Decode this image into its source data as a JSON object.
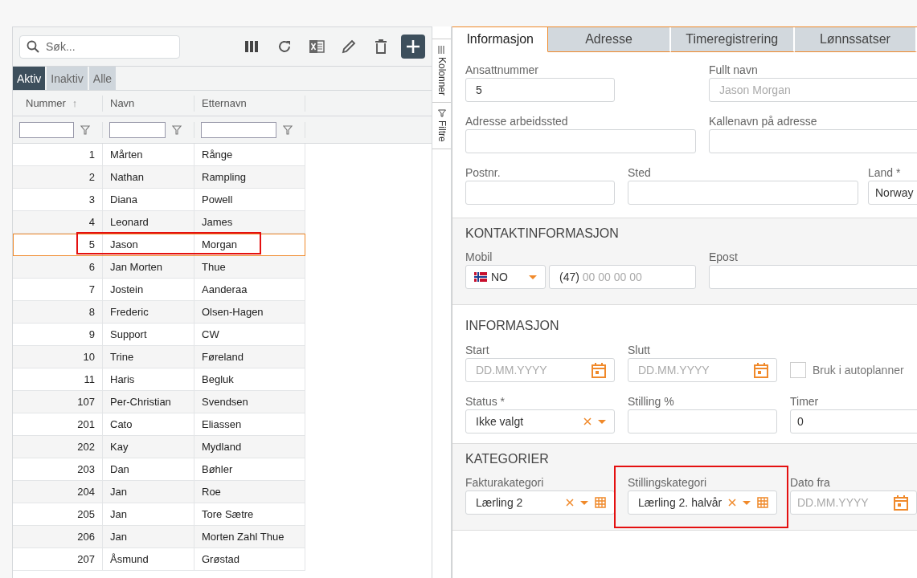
{
  "list_panel": {
    "search": {
      "placeholder": "Søk..."
    },
    "toolbar_buttons": [
      {
        "kind": "columns"
      },
      {
        "kind": "refresh"
      },
      {
        "kind": "excel"
      },
      {
        "kind": "edit"
      },
      {
        "kind": "delete"
      },
      {
        "kind": "add"
      }
    ],
    "filter_tabs": [
      {
        "label": "Aktiv",
        "selected": true
      },
      {
        "label": "Inaktiv",
        "selected": false
      },
      {
        "label": "Alle",
        "selected": false
      }
    ],
    "table": {
      "columns": [
        {
          "label": "Nummer",
          "sort_indicator": "↑"
        },
        {
          "label": "Navn"
        },
        {
          "label": "Etternavn"
        }
      ],
      "rows": [
        {
          "cells": [
            "1",
            "Mårten",
            "Rånge"
          ],
          "selected": false,
          "highlighted": false
        },
        {
          "cells": [
            "2",
            "Nathan",
            "Rampling"
          ],
          "selected": false,
          "highlighted": false
        },
        {
          "cells": [
            "3",
            "Diana",
            "Powell"
          ],
          "selected": false,
          "highlighted": false
        },
        {
          "cells": [
            "4",
            "Leonard",
            "James"
          ],
          "selected": false,
          "highlighted": false
        },
        {
          "cells": [
            "5",
            "Jason",
            "Morgan"
          ],
          "selected": true,
          "highlighted": true
        },
        {
          "cells": [
            "6",
            "Jan Morten",
            "Thue"
          ],
          "selected": false,
          "highlighted": false
        },
        {
          "cells": [
            "7",
            "Jostein",
            "Aanderaa"
          ],
          "selected": false,
          "highlighted": false
        },
        {
          "cells": [
            "8",
            "Frederic",
            "Olsen-Hagen"
          ],
          "selected": false,
          "highlighted": false
        },
        {
          "cells": [
            "9",
            "Support",
            "CW"
          ],
          "selected": false,
          "highlighted": false
        },
        {
          "cells": [
            "10",
            "Trine",
            "Føreland"
          ],
          "selected": false,
          "highlighted": false
        },
        {
          "cells": [
            "11",
            "Haris",
            "Begluk"
          ],
          "selected": false,
          "highlighted": false
        },
        {
          "cells": [
            "107",
            "Per-Christian",
            "Svendsen"
          ],
          "selected": false,
          "highlighted": false
        },
        {
          "cells": [
            "201",
            "Cato",
            "Eliassen"
          ],
          "selected": false,
          "highlighted": false
        },
        {
          "cells": [
            "202",
            "Kay",
            "Mydland"
          ],
          "selected": false,
          "highlighted": false
        },
        {
          "cells": [
            "203",
            "Dan",
            "Bøhler"
          ],
          "selected": false,
          "highlighted": false
        },
        {
          "cells": [
            "204",
            "Jan",
            "Roe"
          ],
          "selected": false,
          "highlighted": false
        },
        {
          "cells": [
            "205",
            "Jan",
            "Tore Sætre"
          ],
          "selected": false,
          "highlighted": false
        },
        {
          "cells": [
            "206",
            "Jan",
            "Morten Zahl Thue"
          ],
          "selected": false,
          "highlighted": false
        },
        {
          "cells": [
            "207",
            "Åsmund",
            "Grøstad"
          ],
          "selected": false,
          "highlighted": false
        }
      ]
    }
  },
  "side_tabs": [
    {
      "label": "Kolonner",
      "kind": "columns"
    },
    {
      "label": "Filtre",
      "kind": "filter"
    }
  ],
  "detail": {
    "tabs": [
      {
        "label": "Informasjon",
        "selected": true
      },
      {
        "label": "Adresse",
        "selected": false
      },
      {
        "label": "Timeregistrering",
        "selected": false
      },
      {
        "label": "Lønnssatser",
        "selected": false
      }
    ],
    "sections": [
      {
        "rows": [
          [
            {
              "kind": "text",
              "label": "Ansattnummer",
              "value": "5",
              "disabled": false
            },
            {
              "kind": "text",
              "label": "Fullt navn",
              "value": "Jason Morgan",
              "disabled": true
            }
          ],
          [
            {
              "kind": "text",
              "label": "Adresse arbeidssted"
            },
            {
              "kind": "text",
              "label": "Kallenavn på adresse"
            }
          ],
          [
            {
              "kind": "text",
              "label": "Postnr."
            },
            {
              "kind": "text",
              "label": "Sted"
            },
            {
              "kind": "text",
              "label": "Land *",
              "value": "Norway"
            }
          ]
        ]
      },
      {
        "title": "KONTAKTINFORMASJON",
        "rows": [
          [
            {
              "kind": "phone",
              "label": "Mobil",
              "country": "NO",
              "prefix": "(47)",
              "placeholder": "00 00 00 00"
            },
            {
              "kind": "text",
              "label": "Epost"
            }
          ]
        ]
      },
      {
        "title": "INFORMASJON",
        "rows": [
          [
            {
              "kind": "date",
              "label": "Start",
              "placeholder": "DD.MM.YYYY"
            },
            {
              "kind": "date",
              "label": "Slutt",
              "placeholder": "DD.MM.YYYY"
            },
            {
              "kind": "checkbox",
              "label": "Bruk i autoplanner",
              "checked": false
            }
          ],
          [
            {
              "kind": "select",
              "label": "Status *",
              "value": "Ikke valgt"
            },
            {
              "kind": "text",
              "label": "Stilling %"
            },
            {
              "kind": "text",
              "label": "Timer",
              "value": "0"
            }
          ]
        ]
      },
      {
        "title": "KATEGORIER",
        "rows": [
          [
            {
              "kind": "category",
              "label": "Fakturakategori",
              "value": "Lærling 2"
            },
            {
              "kind": "category",
              "label": "Stillingskategori",
              "value": "Lærling 2. halvår",
              "highlighted": true
            },
            {
              "kind": "date",
              "label": "Dato fra",
              "placeholder": "DD.MM.YYYY"
            }
          ]
        ]
      }
    ]
  }
}
